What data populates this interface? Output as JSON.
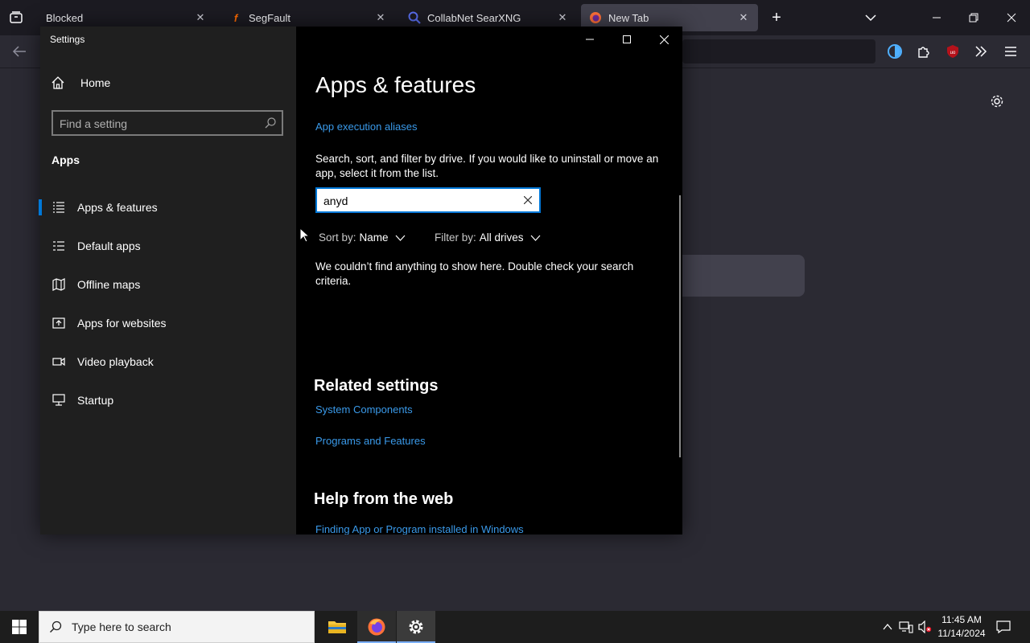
{
  "browser": {
    "tabs": [
      {
        "title": "Blocked",
        "active": false
      },
      {
        "title": "SegFault",
        "active": false
      },
      {
        "title": "CollabNet SearXNG",
        "active": false
      },
      {
        "title": "New Tab",
        "active": true
      }
    ],
    "accent": "#42414d"
  },
  "settings": {
    "window_title": "Settings",
    "home_label": "Home",
    "search_placeholder": "Find a setting",
    "section_label": "Apps",
    "nav_items": [
      {
        "label": "Apps & features",
        "icon": "list-icon",
        "selected": true
      },
      {
        "label": "Default apps",
        "icon": "default-apps-icon",
        "selected": false
      },
      {
        "label": "Offline maps",
        "icon": "map-icon",
        "selected": false
      },
      {
        "label": "Apps for websites",
        "icon": "open-in-app-icon",
        "selected": false
      },
      {
        "label": "Video playback",
        "icon": "video-icon",
        "selected": false
      },
      {
        "label": "Startup",
        "icon": "startup-icon",
        "selected": false
      }
    ],
    "content": {
      "title": "Apps & features",
      "execution_aliases_link": "App execution aliases",
      "description": "Search, sort, and filter by drive. If you would like to uninstall or move an app, select it from the list.",
      "search_value": "anyd",
      "sort_label": "Sort by:",
      "sort_value": "Name",
      "filter_label": "Filter by:",
      "filter_value": "All drives",
      "empty_message": "We couldn’t find anything to show here. Double check your search criteria.",
      "related_heading": "Related settings",
      "related_links": [
        "System Components",
        "Programs and Features"
      ],
      "help_heading": "Help from the web",
      "help_link": "Finding App or Program installed in Windows"
    },
    "link_color": "#3a9aea",
    "accent": "#0078d7"
  },
  "taskbar": {
    "search_placeholder": "Type here to search",
    "time": "11:45 AM",
    "date": "11/14/2024"
  }
}
